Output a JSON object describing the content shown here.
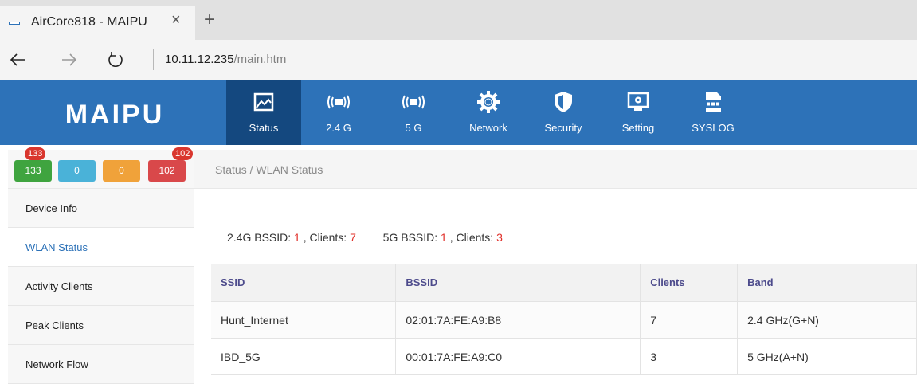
{
  "browser": {
    "tab_title": "AirCore818 - MAIPU",
    "close_glyph": "×",
    "new_tab_glyph": "+",
    "url_host": "10.11.12.235",
    "url_path": "/main.htm"
  },
  "header": {
    "brand_color": "#2d72b8",
    "active_color": "#14487f",
    "nav": [
      {
        "label": "Status",
        "icon": "status-image-icon"
      },
      {
        "label": "2.4 G",
        "icon": "wifi-24-icon"
      },
      {
        "label": "5 G",
        "icon": "wifi-5-icon"
      },
      {
        "label": "Network",
        "icon": "network-gear-icon"
      },
      {
        "label": "Security",
        "icon": "shield-icon"
      },
      {
        "label": "Setting",
        "icon": "monitor-settings-icon"
      },
      {
        "label": "SYSLOG",
        "icon": "log-icon"
      }
    ]
  },
  "sidebar": {
    "status_buttons": [
      {
        "value": "133",
        "color": "#3fa43f",
        "badge": "133"
      },
      {
        "value": "0",
        "color": "#4ab2d8"
      },
      {
        "value": "0",
        "color": "#f0a23a"
      },
      {
        "value": "102",
        "color": "#d9484a",
        "badge": "102"
      }
    ],
    "items": [
      {
        "label": "Device Info"
      },
      {
        "label": "WLAN Status",
        "active": true
      },
      {
        "label": "Activity Clients"
      },
      {
        "label": "Peak Clients"
      },
      {
        "label": "Network Flow"
      }
    ]
  },
  "main": {
    "breadcrumb": "Status / WLAN Status",
    "summary": {
      "bssid24_label": "2.4G BSSID:",
      "bssid24_value": "1",
      "clients24_label": ", Clients:",
      "clients24_value": "7",
      "bssid5_label": "5G BSSID:",
      "bssid5_value": "1",
      "clients5_label": ", Clients:",
      "clients5_value": "3"
    },
    "table": {
      "headers": [
        "SSID",
        "BSSID",
        "Clients",
        "Band"
      ],
      "rows": [
        [
          "Hunt_Internet",
          "02:01:7A:FE:A9:B8",
          "7",
          "2.4 GHz(G+N)"
        ],
        [
          "IBD_5G",
          "00:01:7A:FE:A9:C0",
          "3",
          "5 GHz(A+N)"
        ]
      ]
    }
  }
}
